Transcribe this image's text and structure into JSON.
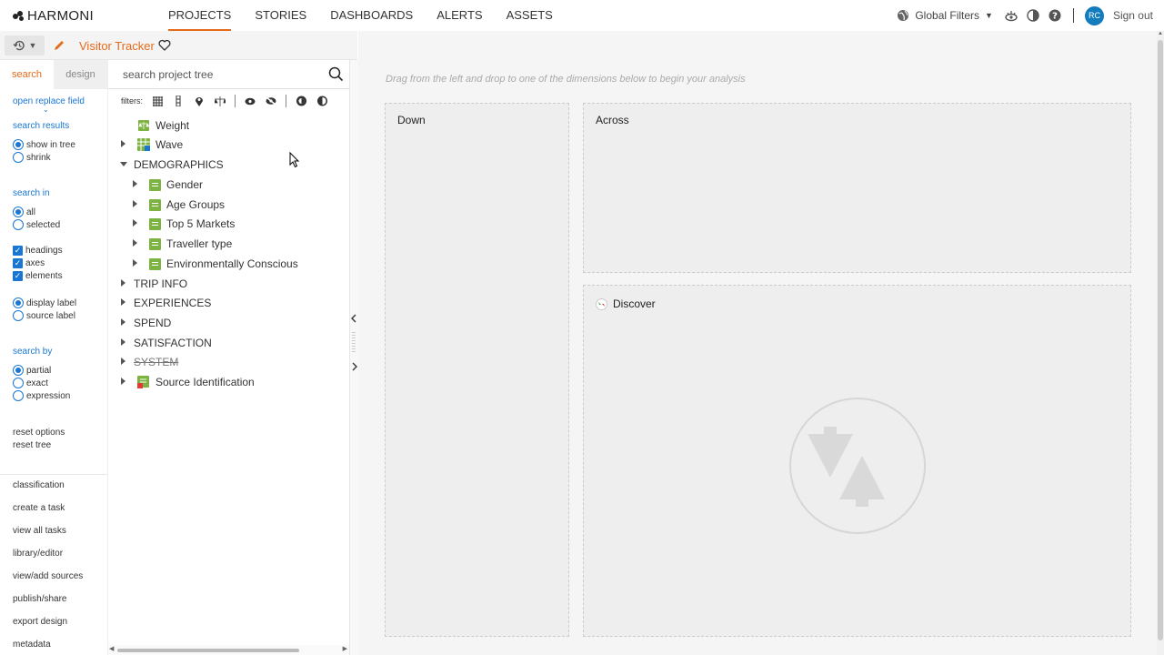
{
  "app": {
    "brand": "HARMONI",
    "nav": [
      "PROJECTS",
      "STORIES",
      "DASHBOARDS",
      "ALERTS",
      "ASSETS"
    ],
    "active_nav": "PROJECTS",
    "global_filters": "Global Filters",
    "user_initials": "RC",
    "sign_out": "Sign out"
  },
  "project": {
    "title": "Visitor Tracker"
  },
  "sidebar": {
    "tab_search": "search",
    "tab_design": "design",
    "open_replace": "open replace field",
    "search_results_label": "search results",
    "show_in_tree": "show in tree",
    "shrink": "shrink",
    "search_in_label": "search in",
    "all": "all",
    "selected": "selected",
    "headings": "headings",
    "axes": "axes",
    "elements": "elements",
    "display_label": "display label",
    "source_label": "source label",
    "search_by_label": "search by",
    "partial": "partial",
    "exact": "exact",
    "expression": "expression",
    "reset_options": "reset options",
    "reset_tree": "reset tree",
    "menu": [
      "classification",
      "create a task",
      "view all tasks",
      "library/editor",
      "view/add sources",
      "publish/share",
      "export design",
      "metadata"
    ]
  },
  "tree": {
    "search_placeholder": "search project tree",
    "filters_label": "filters:",
    "nodes": {
      "weight": "Weight",
      "wave": "Wave",
      "demographics": "DEMOGRAPHICS",
      "gender": "Gender",
      "age_groups": "Age Groups",
      "top5": "Top 5 Markets",
      "traveller": "Traveller type",
      "env": "Environmentally Conscious",
      "trip": "TRIP INFO",
      "experiences": "EXPERIENCES",
      "spend": "SPEND",
      "satisfaction": "SATISFACTION",
      "system": "SYSTEM",
      "source_id": "Source Identification"
    }
  },
  "workspace": {
    "hint": "Drag from the left and drop to one of the dimensions below to begin your analysis",
    "down": "Down",
    "across": "Across",
    "discover": "Discover"
  },
  "colors": {
    "accent": "#e56a19",
    "link": "#1976d2",
    "node_icon": "#7cb342"
  }
}
